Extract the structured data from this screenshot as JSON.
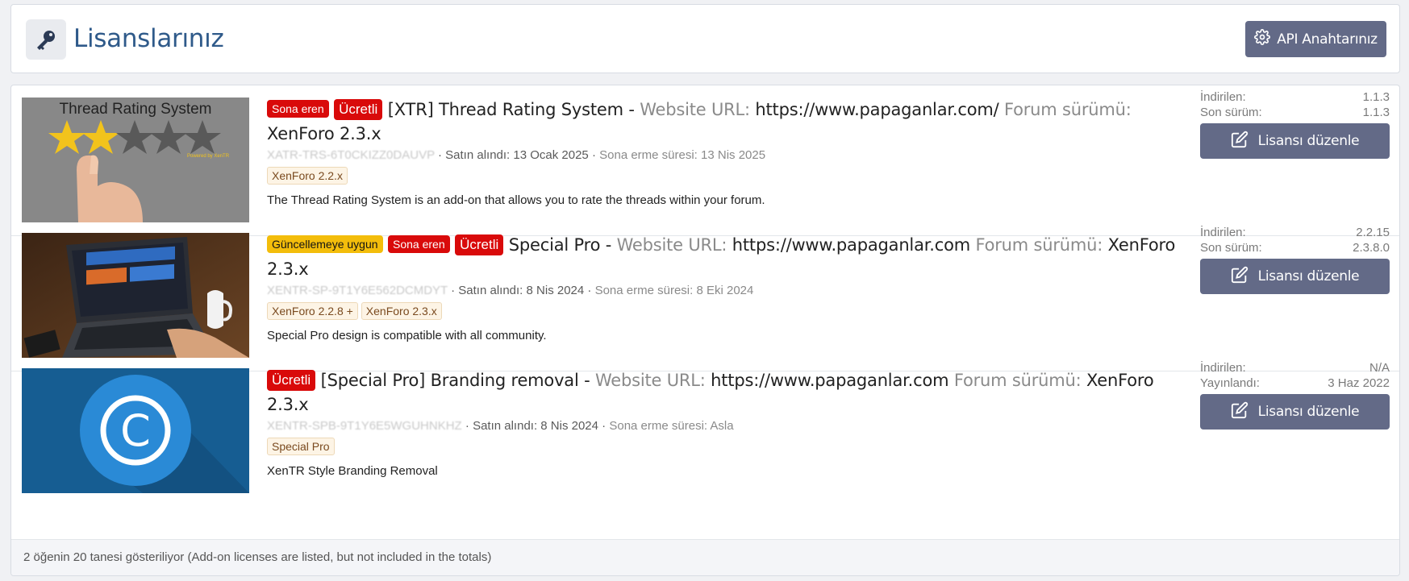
{
  "header": {
    "title": "Lisanslarınız",
    "icon": "key-icon",
    "api_button_label": "API Anahtarınız",
    "api_button_icon": "gear-icon"
  },
  "licenses": [
    {
      "thumb_text": "Thread Rating System",
      "thumb_caption": "Powered by XenTR",
      "badges": [
        "Sona eren",
        "Ücretli"
      ],
      "title": "[XTR] Thread Rating System -",
      "url_label": "Website URL:",
      "url": "https://www.papaganlar.com/",
      "forum_label": "Forum sürümü:",
      "forum_version": "XenForo 2.3.x",
      "license_key": "XATR-TRS-6T0CKIZZ0DAUVP",
      "purchased": "Satın alındı: 13 Ocak 2025",
      "expires": "Sona erme süresi: 13 Nis 2025",
      "tags": [
        "XenForo 2.2.x"
      ],
      "description": "The Thread Rating System is an add-on that allows you to rate the threads within your forum.",
      "stat1_label": "İndirilen:",
      "stat1_value": "1.1.3",
      "stat2_label": "Son sürüm:",
      "stat2_value": "1.1.3",
      "button_label": "Lisansı düzenle"
    },
    {
      "badges": [
        "Güncellemeye uygun",
        "Sona eren",
        "Ücretli"
      ],
      "title": "Special Pro -",
      "url_label": "Website URL:",
      "url": "https://www.papaganlar.com",
      "forum_label": "Forum sürümü:",
      "forum_version": "XenForo 2.3.x",
      "license_key": "XENTR-SP-9T1Y6E562DCMDYT",
      "purchased": "Satın alındı: 8 Nis 2024",
      "expires": "Sona erme süresi: 8 Eki 2024",
      "tags": [
        "XenForo 2.2.8 +",
        "XenForo 2.3.x"
      ],
      "description": "Special Pro design is compatible with all community.",
      "stat1_label": "İndirilen:",
      "stat1_value": "2.2.15",
      "stat2_label": "Son sürüm:",
      "stat2_value": "2.3.8.0",
      "button_label": "Lisansı düzenle"
    },
    {
      "badges": [
        "Ücretli"
      ],
      "title": "[Special Pro] Branding removal -",
      "url_label": "Website URL:",
      "url": "https://www.papaganlar.com",
      "forum_label": "Forum sürümü:",
      "forum_version": "XenForo 2.3.x",
      "license_key": "XENTR-SPB-9T1Y6E5WGUHNKHZ",
      "purchased": "Satın alındı: 8 Nis 2024",
      "expires": "Sona erme süresi: Asla",
      "tags": [
        "Special Pro"
      ],
      "description": "XenTR Style Branding Removal",
      "stat1_label": "İndirilen:",
      "stat1_value": "N/A",
      "stat2_label": "Yayınlandı:",
      "stat2_value": "3 Haz 2022",
      "button_label": "Lisansı düzenle"
    }
  ],
  "footer": {
    "text": "2 öğenin 20 tanesi gösteriliyor (Add-on licenses are listed, but not included in the totals)"
  },
  "colors": {
    "button": "#636a87",
    "title": "#2f5a8a",
    "badge_red": "#d90a0a",
    "badge_yellow": "#f3bd0b"
  }
}
